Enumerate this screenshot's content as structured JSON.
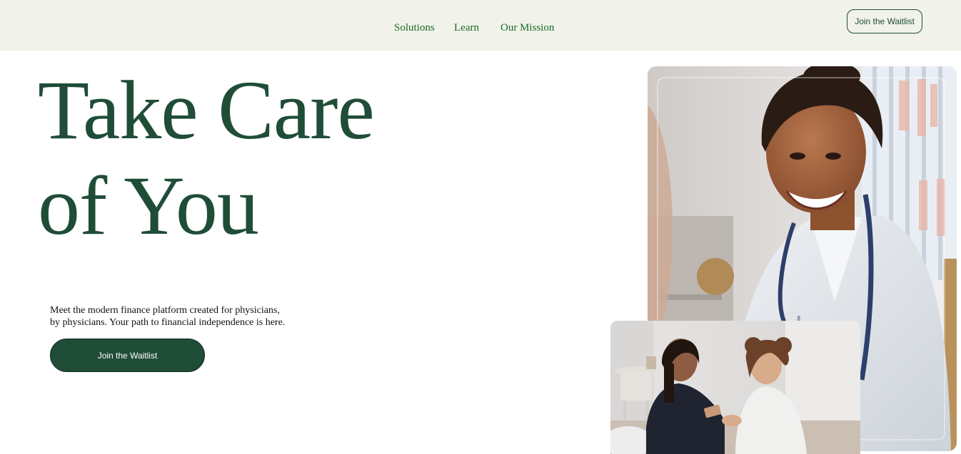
{
  "nav": {
    "links": [
      "Solutions",
      "Learn",
      "Our Mission"
    ],
    "waitlist_label": "Join the Waitlist"
  },
  "hero": {
    "title_lines": [
      "Take Care",
      "of You"
    ],
    "description_lines": [
      "Meet the modern finance platform created for physicians,",
      "by physicians. Your path to financial independence is here."
    ],
    "cta_label": "Join the Waitlist"
  },
  "images": {
    "main_photo": "smiling-physician-photo",
    "secondary_photo": "two-women-looking-at-phone-photo"
  },
  "colors": {
    "brand_green": "#1f4d37",
    "nav_text": "#1c6b2b",
    "topbar_bg": "#f1f2ea"
  }
}
